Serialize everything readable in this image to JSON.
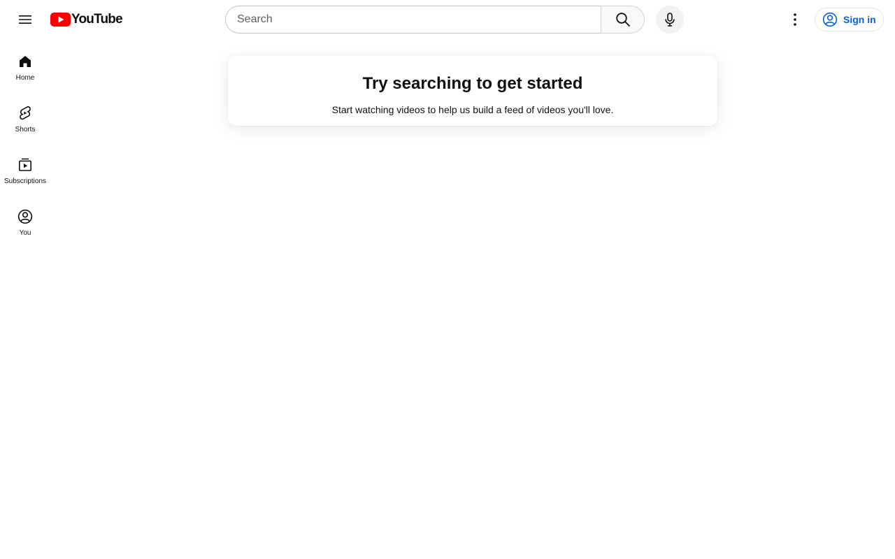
{
  "header": {
    "logo_text": "YouTube",
    "search_placeholder": "Search",
    "signin_label": "Sign in"
  },
  "guide": {
    "items": [
      {
        "label": "Home",
        "icon": "home-icon"
      },
      {
        "label": "Shorts",
        "icon": "shorts-icon"
      },
      {
        "label": "Subscriptions",
        "icon": "subscriptions-icon"
      },
      {
        "label": "You",
        "icon": "account-circle-icon"
      }
    ]
  },
  "main": {
    "title": "Try searching to get started",
    "subtitle": "Start watching videos to help us build a feed of videos you'll love."
  },
  "colors": {
    "brand_red": "#ff0000",
    "link_blue": "#065fd4",
    "text": "#0f0f0f"
  }
}
